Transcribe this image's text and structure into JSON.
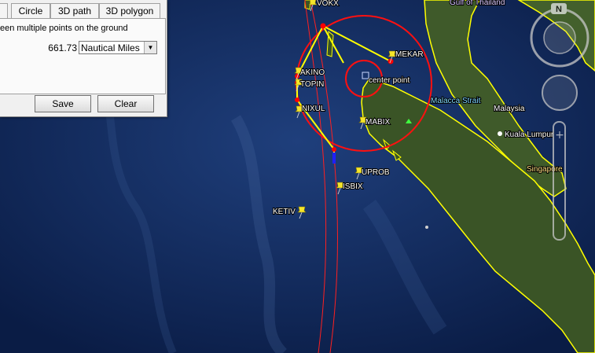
{
  "panel": {
    "tabs": [
      {
        "label": ""
      },
      {
        "label": "Circle"
      },
      {
        "label": "3D path"
      },
      {
        "label": "3D polygon"
      }
    ],
    "description": "een multiple points on the ground",
    "distance_value": "661.73",
    "unit_selected": "Nautical Miles",
    "save_label": "Save",
    "clear_label": "Clear"
  },
  "map": {
    "placemarks": [
      {
        "name": "VOKX"
      },
      {
        "name": "MEKAR"
      },
      {
        "name": "AKINO"
      },
      {
        "name": "TOPIN"
      },
      {
        "name": "NIXUL"
      },
      {
        "name": "MABIX"
      },
      {
        "name": "UPROB"
      },
      {
        "name": "ISBIX"
      },
      {
        "name": "KETIV"
      }
    ],
    "center_label": "center point",
    "geo_labels": {
      "gulf": "Gulf of Thailand",
      "malacca": "Malacca Strait",
      "malaysia": "Malaysia",
      "kl": "Kuala Lumpur",
      "singapore": "Singapore"
    },
    "nav": {
      "north": "N"
    },
    "colors": {
      "ocean": "#0d2350",
      "land": "#3f5a2a",
      "border": "#ffff00",
      "circle": "#ff0000",
      "path": "#ffff00"
    }
  }
}
